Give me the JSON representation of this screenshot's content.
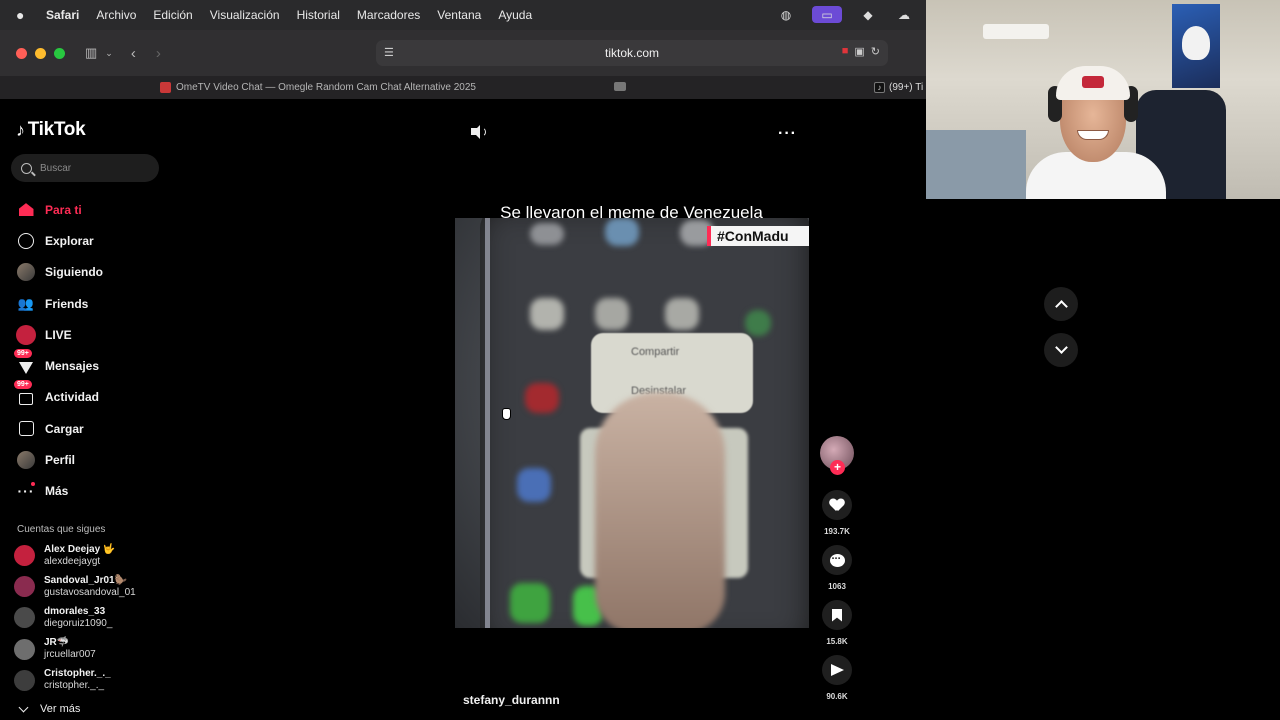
{
  "menubar": {
    "app": "Safari",
    "items": [
      "Archivo",
      "Edición",
      "Visualización",
      "Historial",
      "Marcadores",
      "Ventana",
      "Ayuda"
    ]
  },
  "toolbar": {
    "url": "tiktok.com"
  },
  "tabs": {
    "tab1_title": "OmeTV Video Chat — Omegle Random Cam Chat Alternative 2025",
    "tab2_title": "(99+) Ti"
  },
  "sidebar": {
    "logo_text": "TikTok",
    "search_placeholder": "Buscar",
    "nav": [
      {
        "label": "Para ti",
        "icon": "home-icon",
        "active": true
      },
      {
        "label": "Explorar",
        "icon": "compass-icon"
      },
      {
        "label": "Siguiendo",
        "icon": "following-avatar-icon"
      },
      {
        "label": "Friends",
        "icon": "friends-icon"
      },
      {
        "label": "LIVE",
        "icon": "live-icon"
      },
      {
        "label": "Mensajes",
        "icon": "messages-icon",
        "badge": "99+"
      },
      {
        "label": "Actividad",
        "icon": "activity-icon",
        "badge": "99+"
      },
      {
        "label": "Cargar",
        "icon": "upload-icon"
      },
      {
        "label": "Perfil",
        "icon": "profile-avatar-icon"
      },
      {
        "label": "Más",
        "icon": "more-icon"
      }
    ],
    "following_title": "Cuentas que sigues",
    "following": [
      {
        "name": "Alex Deejay 🤟",
        "handle": "alexdeejaygt",
        "avatar_color": "#c4213e"
      },
      {
        "name": "Sandoval_Jr01🦫",
        "handle": "gustavosandoval_01",
        "avatar_color": "#8a2b4f"
      },
      {
        "name": "dmorales_33",
        "handle": "diegoruiz1090_",
        "avatar_color": "#4a4a4a"
      },
      {
        "name": "JR🦈",
        "handle": "jrcuellar007",
        "avatar_color": "#6e6e6e"
      },
      {
        "name": "Cristopher._._",
        "handle": "cristopher._._",
        "avatar_color": "#3d3d3d"
      }
    ],
    "see_more": "Ver más"
  },
  "video": {
    "title": "Se llevaron el meme de Venezuela",
    "hashtag_overlay": "#ConMadu",
    "menu_option_1": "Compartir",
    "menu_option_2": "Desinstalar",
    "username": "stefany_durannn"
  },
  "actions": {
    "likes": "193.7K",
    "comments": "1063",
    "saves": "15.8K",
    "shares": "90.6K"
  },
  "colors": {
    "tiktok_accent": "#fe2c55",
    "background": "#000000"
  }
}
